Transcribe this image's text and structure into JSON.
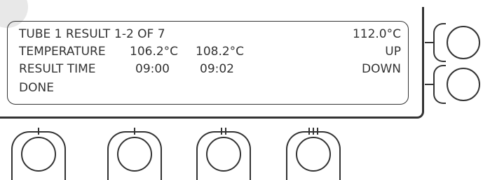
{
  "display": {
    "row1": {
      "label": "TUBE 1 RESULT",
      "range": "1-2 OF 7",
      "right": "112.0°C"
    },
    "row2": {
      "label": "TEMPERATURE",
      "v1": "106.2°C",
      "v2": "108.2°C",
      "right": "UP"
    },
    "row3": {
      "label": "RESULT TIME",
      "v1": "09:00",
      "v2": "09:02",
      "right": "DOWN"
    },
    "row4": {
      "label": "DONE"
    }
  },
  "soft_keys": [
    {
      "ticks": 1
    },
    {
      "ticks": 1
    },
    {
      "ticks": 2
    },
    {
      "ticks": 3
    }
  ]
}
